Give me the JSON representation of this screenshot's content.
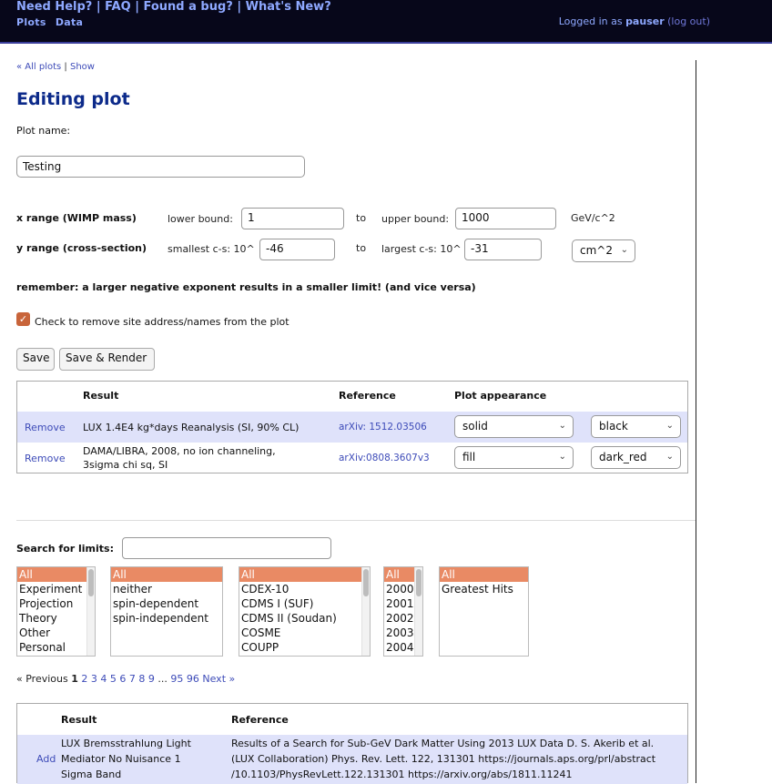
{
  "header": {
    "help_links": [
      "Need Help?",
      "FAQ",
      "Found a bug?",
      "What's New?"
    ],
    "nav": [
      "Plots",
      "Data"
    ],
    "logged_in_prefix": "Logged in as",
    "username": "pauser",
    "logout": "(log out)"
  },
  "crumbs": {
    "all_plots": "« All plots",
    "show": "Show"
  },
  "page": {
    "title": "Editing plot",
    "plot_name_label": "Plot name:",
    "plot_name_value": "Testing"
  },
  "ranges": {
    "x_label": "x range (WIMP mass)",
    "x_lower_label": "lower bound:",
    "x_lower_value": "1",
    "x_to": "to",
    "x_upper_label": "upper bound:",
    "x_upper_value": "1000",
    "x_unit": "GeV/c^2",
    "y_label": "y range (cross-section)",
    "y_small_label": "smallest c-s: 10^",
    "y_small_value": "-46",
    "y_to": "to",
    "y_large_label": "largest c-s: 10^",
    "y_large_value": "-31",
    "y_unit": "cm^2"
  },
  "remember": "remember: a larger negative exponent results in a smaller limit! (and vice versa)",
  "checkbox": {
    "label": "Check to remove site address/names from the plot",
    "checked": true
  },
  "buttons": {
    "save": "Save",
    "save_render": "Save & Render"
  },
  "selected_table": {
    "headers": {
      "result": "Result",
      "reference": "Reference",
      "appearance": "Plot appearance"
    },
    "rows": [
      {
        "action": "Remove",
        "result": "LUX 1.4E4 kg*days Reanalysis (SI, 90% CL)",
        "reference": "arXiv: 1512.03506",
        "style": "solid",
        "color": "black"
      },
      {
        "action": "Remove",
        "result_line1": "DAMA/LIBRA, 2008, no ion channeling,",
        "result_line2": "3sigma chi sq, SI",
        "reference": "arXiv:0808.3607v3",
        "style": "fill",
        "color": "dark_red"
      }
    ]
  },
  "search": {
    "label": "Search for limits:",
    "value": "",
    "lists": {
      "category": [
        "All",
        "Experiment",
        "Projection",
        "Theory",
        "Other",
        "Personal"
      ],
      "spin": [
        "All",
        "neither",
        "spin-dependent",
        "spin-independent"
      ],
      "experiment": [
        "All",
        "CDEX-10",
        "CDMS I (SUF)",
        "CDMS II (Soudan)",
        "COSME",
        "COUPP"
      ],
      "year": [
        "All",
        "2000",
        "2001",
        "2002",
        "2003",
        "2004"
      ],
      "greatest": [
        "All",
        "Greatest Hits"
      ]
    }
  },
  "pager": {
    "previous": "« Previous",
    "current": "1",
    "pages": [
      "2",
      "3",
      "4",
      "5",
      "6",
      "7",
      "8",
      "9"
    ],
    "ellipsis": "...",
    "last_pages": [
      "95",
      "96"
    ],
    "next": "Next »"
  },
  "results_table": {
    "headers": {
      "result": "Result",
      "reference": "Reference"
    },
    "rows": [
      {
        "action": "Add",
        "result_line1": "LUX Bremsstrahlung Light",
        "result_line2": "Mediator No Nuisance 1",
        "result_line3": "Sigma Band",
        "ref_line1": "Results of a Search for Sub-GeV Dark Matter Using 2013 LUX Data D. S. Akerib et al.",
        "ref_line2": "(LUX Collaboration) Phys. Rev. Lett. 122, 131301 https://journals.aps.org/prl/abstract",
        "ref_line3": "/10.1103/PhysRevLett.122.131301 https://arxiv.org/abs/1811.11241"
      }
    ]
  },
  "colors": {
    "header_bg": "#07071a",
    "title": "#0c2a8a",
    "link": "#3d4bb8",
    "selected_option": "#e98a64",
    "row_highlight": "#dfe2fa"
  }
}
